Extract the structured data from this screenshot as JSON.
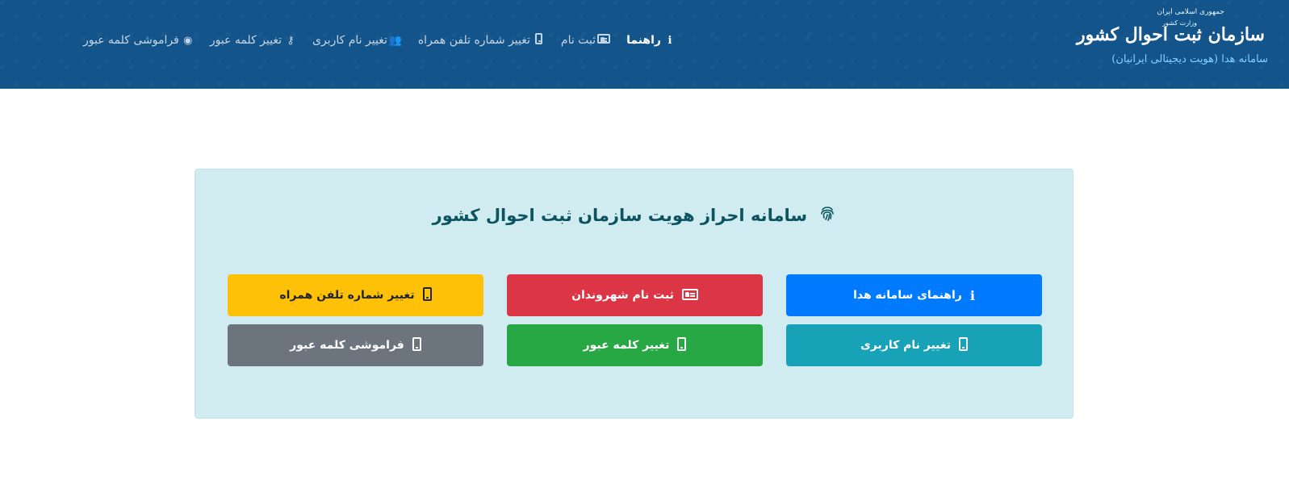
{
  "header": {
    "logo": {
      "line1": "جمهوری اسلامی ایران",
      "line2": "وزارت کشور",
      "line3": "سازمان ثبت احوال کشور",
      "line4": "سامانه هدا (هویت دیجیتالی ایرانیان)"
    },
    "nav": [
      {
        "label": "راهنما",
        "icon": "info-icon",
        "active": true
      },
      {
        "label": "ثبت نام",
        "icon": "id-card-icon",
        "active": false
      },
      {
        "label": "تغییر شماره تلفن همراه",
        "icon": "mobile-icon",
        "active": false
      },
      {
        "label": "تغییر نام کاربری",
        "icon": "users-icon",
        "active": false
      },
      {
        "label": "تغییر کلمه عبور",
        "icon": "key-icon",
        "active": false
      },
      {
        "label": "فراموشی کلمه عبور",
        "icon": "eye-icon",
        "active": false
      }
    ]
  },
  "card": {
    "title": "سامانه احراز هویت سازمان ثبت احوال کشور",
    "title_icon": "fingerprint-icon",
    "buttons": [
      {
        "label": "راهنمای سامانه هدا",
        "icon": "info-icon",
        "color": "#007bff"
      },
      {
        "label": "ثبت نام شهروندان",
        "icon": "id-card-icon",
        "color": "#dc3545"
      },
      {
        "label": "تغییر شماره تلفن همراه",
        "icon": "mobile-icon",
        "color": "#ffc107"
      },
      {
        "label": "تغییر نام کاربری",
        "icon": "mobile-icon",
        "color": "#17a2b8"
      },
      {
        "label": "تغییر کلمه عبور",
        "icon": "mobile-icon",
        "color": "#28a745"
      },
      {
        "label": "فراموشی کلمه عبور",
        "icon": "mobile-icon",
        "color": "#6c757d"
      }
    ]
  },
  "colors": {
    "header_bg": "#13548a",
    "card_bg": "#d1ecf1",
    "card_title": "#0c5460"
  }
}
